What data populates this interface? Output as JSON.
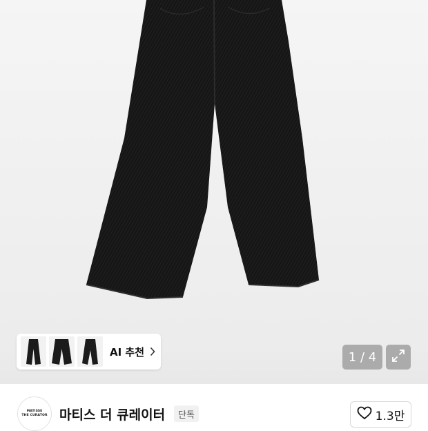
{
  "ai_recommend": {
    "label": "AI 추천"
  },
  "gallery": {
    "counter": "1 / 4"
  },
  "brand": {
    "logo_line1": "MATISSE",
    "logo_line2": "THE CURATOR",
    "name": "마티스 더 큐레이터",
    "badge": "단독"
  },
  "like": {
    "count": "1.3만"
  },
  "icons": {
    "chevron": "chevron-right-icon",
    "expand": "expand-icon",
    "heart": "heart-outline-icon"
  },
  "colors": {
    "product": "#141414",
    "counter_bg": "#969696"
  }
}
